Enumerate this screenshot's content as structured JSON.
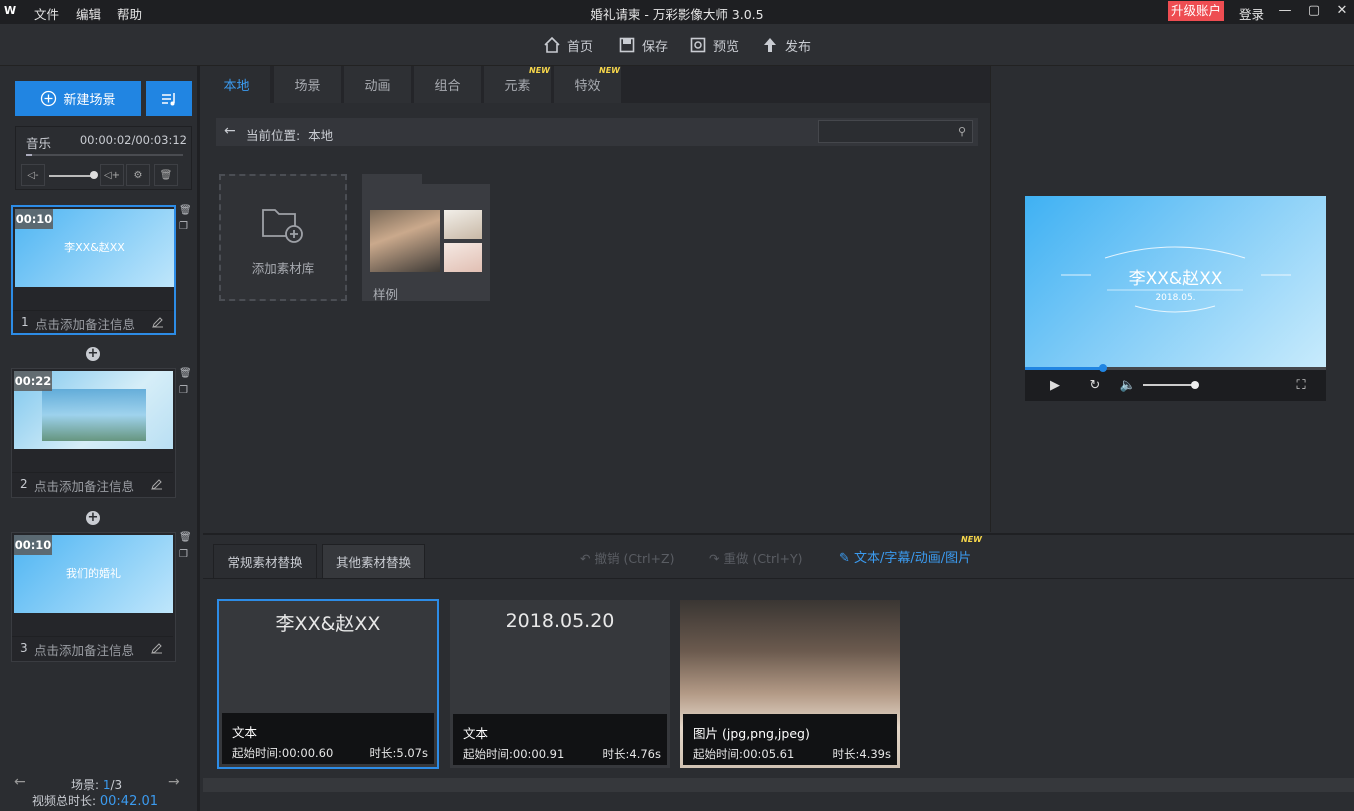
{
  "titlebar": {
    "logo": "W",
    "menu": [
      "文件",
      "编辑",
      "帮助"
    ],
    "title": "婚礼请柬 - 万彩影像大师 3.0.5",
    "upgrade": "升级账户",
    "login": "登录"
  },
  "toolbar": {
    "home": "首页",
    "save": "保存",
    "preview": "预览",
    "publish": "发布"
  },
  "left": {
    "new_scene": "新建场景",
    "music_label": "音乐",
    "music_time": "00:00:02/00:03:12",
    "scenes": [
      {
        "num": "1",
        "duration": "00:10",
        "title": "李XX&赵XX",
        "note": "点击添加备注信息"
      },
      {
        "num": "2",
        "duration": "00:22",
        "title": "",
        "note": "点击添加备注信息"
      },
      {
        "num": "3",
        "duration": "00:10",
        "title": "我们的婚礼",
        "note": "点击添加备注信息"
      }
    ],
    "pager_label": "场景:",
    "pager_current": "1",
    "pager_total": "/3",
    "total_label": "视频总时长:",
    "total_value": "00:42.01"
  },
  "center": {
    "tabs": [
      "本地",
      "场景",
      "动画",
      "组合",
      "元素",
      "特效"
    ],
    "new_badge": "NEW",
    "breadcrumb_label": "当前位置:",
    "breadcrumb_value": "本地",
    "search_placeholder": "",
    "add_library": "添加素材库",
    "folder_label": "样例"
  },
  "preview": {
    "title": "李XX&赵XX",
    "date": "2018.05.",
    "progress": 0.26
  },
  "bottom": {
    "tab_regular": "常规素材替换",
    "tab_other": "其他素材替换",
    "undo": "撤销 (Ctrl+Z)",
    "redo": "重做 (Ctrl+Y)",
    "text_link": "文本/字幕/动画/图片",
    "new_badge": "NEW",
    "cards": [
      {
        "big": "李XX&赵XX",
        "type": "文本",
        "start": "起始时间:00:00.60",
        "duration": "时长:5.07s"
      },
      {
        "big": "2018.05.20",
        "type": "文本",
        "start": "起始时间:00:00.91",
        "duration": "时长:4.76s"
      },
      {
        "big": "",
        "type": "图片 (jpg,png,jpeg)",
        "start": "起始时间:00:05.61",
        "duration": "时长:4.39s"
      }
    ]
  }
}
